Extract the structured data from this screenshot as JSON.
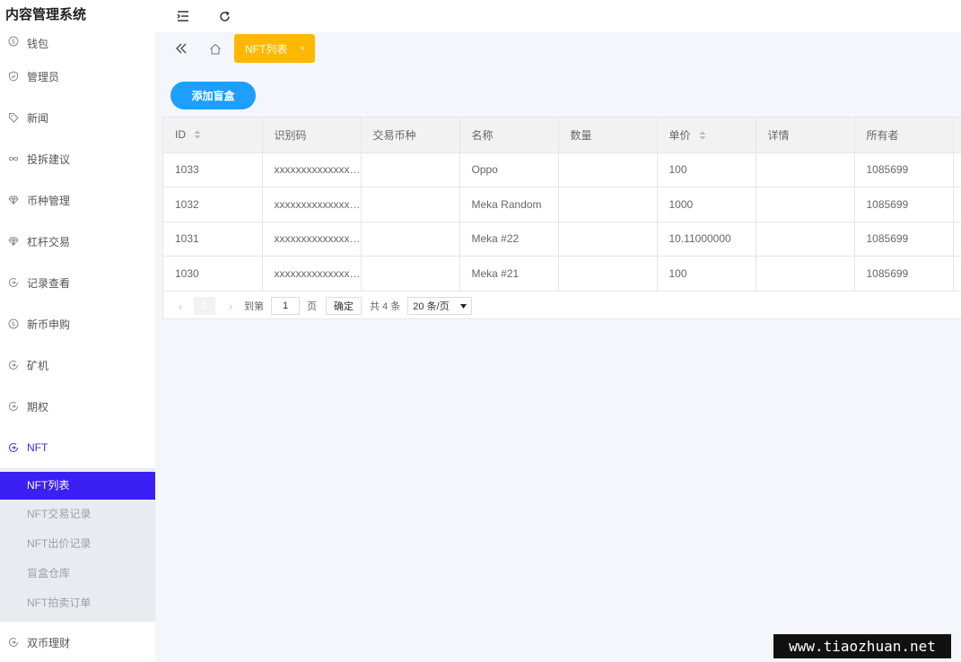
{
  "app": {
    "title": "内容管理系统"
  },
  "sidebar": {
    "items": [
      {
        "label": "钱包",
        "icon": "dollar-circle-icon"
      },
      {
        "label": "管理员",
        "icon": "shield-icon"
      },
      {
        "label": "新闻",
        "icon": "tag-icon"
      },
      {
        "label": "投拆建议",
        "icon": "infinity-icon"
      },
      {
        "label": "币种管理",
        "icon": "diamond-icon"
      },
      {
        "label": "杠杆交易",
        "icon": "diamond-icon"
      },
      {
        "label": "记录查看",
        "icon": "circle-arrow-icon"
      },
      {
        "label": "新币申购",
        "icon": "dollar-circle-icon"
      },
      {
        "label": "矿机",
        "icon": "circle-arrow-icon"
      },
      {
        "label": "期权",
        "icon": "circle-arrow-icon"
      },
      {
        "label": "NFT",
        "icon": "circle-arrow-icon"
      }
    ],
    "nft_submenu": [
      {
        "label": "NFT列表"
      },
      {
        "label": "NFT交易记录"
      },
      {
        "label": "NFT出价记录"
      },
      {
        "label": "盲盒仓库"
      },
      {
        "label": "NFT拍卖订单"
      }
    ],
    "last_item": {
      "label": "双币理财",
      "icon": "circle-arrow-icon"
    }
  },
  "tabs": {
    "active_label": "NFT列表",
    "close_glyph": "×"
  },
  "toolbar": {
    "add_label": "添加盲盒"
  },
  "table": {
    "columns": [
      "ID",
      "识别码",
      "交易币种",
      "名称",
      "数量",
      "单价",
      "详情",
      "所有者",
      ""
    ],
    "rows": [
      [
        "1033",
        "xxxxxxxxxxxxxxxxxxxx",
        "",
        "Oppo",
        "",
        "100",
        "",
        "1085699",
        ""
      ],
      [
        "1032",
        "xxxxxxxxxxxxxxxxxxxx",
        "",
        "Meka Random",
        "",
        "1000",
        "",
        "1085699",
        ""
      ],
      [
        "1031",
        "xxxxxxxxxxxxxxxxxxxx",
        "",
        "Meka #22",
        "",
        "10.11000000",
        "",
        "1085699",
        ""
      ],
      [
        "1030",
        "xxxxxxxxxxxxxxxxxxxx",
        "",
        "Meka #21",
        "",
        "100",
        "",
        "1085699",
        ""
      ]
    ]
  },
  "pagination": {
    "current_page": "1",
    "goto_label": "到第",
    "page_unit": "页",
    "input_value": "1",
    "confirm_label": "确定",
    "total_label": "共 4 条",
    "page_size_label": "20 条/页"
  },
  "colors": {
    "accent": "#3b1ff5",
    "tab_active": "#ffb800",
    "primary_button": "#1e9fff"
  },
  "watermark": {
    "text": "www.tiaozhuan.net"
  }
}
